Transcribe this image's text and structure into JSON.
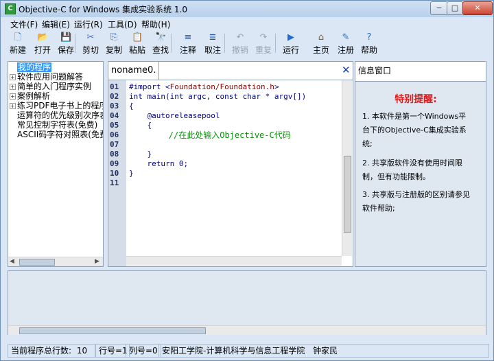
{
  "window": {
    "title": "Objective-C for Windows 集成实验系统 1.0",
    "app_icon_glyph": "C",
    "min_glyph": "−",
    "max_glyph": "□",
    "close_glyph": "✕"
  },
  "menu": [
    {
      "label": "文件(F)"
    },
    {
      "label": "编辑(E)"
    },
    {
      "label": "运行(R)"
    },
    {
      "label": "工具(D)"
    },
    {
      "label": "帮助(H)"
    }
  ],
  "toolbar": [
    {
      "label": "新建",
      "icon": "new-file-icon",
      "glyph": "🗋",
      "color": "#3a6fb0",
      "disabled": false
    },
    {
      "label": "打开",
      "icon": "open-folder-icon",
      "glyph": "📂",
      "color": "#d9a52b",
      "disabled": false
    },
    {
      "label": "保存",
      "icon": "save-icon",
      "glyph": "💾",
      "color": "#2e5aa8",
      "disabled": false
    },
    {
      "label": "剪切",
      "icon": "cut-icon",
      "glyph": "✂",
      "color": "#4a6fb0",
      "disabled": false
    },
    {
      "label": "复制",
      "icon": "copy-icon",
      "glyph": "⎘",
      "color": "#4a6fb0",
      "disabled": false
    },
    {
      "label": "粘贴",
      "icon": "paste-icon",
      "glyph": "📋",
      "color": "#b57c2e",
      "disabled": false
    },
    {
      "label": "查找",
      "icon": "find-icon",
      "glyph": "🔭",
      "color": "#333333",
      "disabled": false
    },
    {
      "label": "注释",
      "icon": "comment-icon",
      "glyph": "≡",
      "color": "#2e5aa8",
      "disabled": false
    },
    {
      "label": "取注",
      "icon": "uncomment-icon",
      "glyph": "≣",
      "color": "#2e5aa8",
      "disabled": false
    },
    {
      "label": "撤销",
      "icon": "undo-icon",
      "glyph": "↶",
      "color": "#9aa5b1",
      "disabled": true
    },
    {
      "label": "重复",
      "icon": "redo-icon",
      "glyph": "↷",
      "color": "#9aa5b1",
      "disabled": true
    },
    {
      "label": "运行",
      "icon": "run-icon",
      "glyph": "▶",
      "color": "#1f6fd0",
      "disabled": false
    },
    {
      "label": "主页",
      "icon": "home-icon",
      "glyph": "⌂",
      "color": "#8a5a2b",
      "disabled": false
    },
    {
      "label": "注册",
      "icon": "register-pen-icon",
      "glyph": "✎",
      "color": "#3a6fb0",
      "disabled": false
    },
    {
      "label": "帮助",
      "icon": "help-icon",
      "glyph": "?",
      "color": "#1f6fd0",
      "disabled": false
    }
  ],
  "tree": {
    "items": [
      {
        "label": "我的程序",
        "expander": "",
        "selected": true
      },
      {
        "label": "软件应用问题解答",
        "expander": "+",
        "selected": false
      },
      {
        "label": "简单的入门程序实例",
        "expander": "+",
        "selected": false
      },
      {
        "label": "案例解析",
        "expander": "+",
        "selected": false
      },
      {
        "label": "练习PDF电子书上的程序",
        "expander": "+",
        "selected": false
      },
      {
        "label": "运算符的优先级别次序表",
        "expander": "",
        "selected": false
      },
      {
        "label": "常见控制字符表(免费)",
        "expander": "",
        "selected": false
      },
      {
        "label": "ASCII码字符对照表(免费)",
        "expander": "",
        "selected": false
      }
    ]
  },
  "editor": {
    "tab_label": "noname0.",
    "close_glyph": "✕",
    "line_numbers": [
      "01",
      "02",
      "03",
      "04",
      "05",
      "06",
      "07",
      "08",
      "09",
      "10",
      "11"
    ],
    "code": [
      {
        "pre": "#import <",
        "mid": "Foundation/Foundation.h",
        "post": ">"
      },
      {
        "pre": "int main(int argc, const char * argv[])",
        "mid": "",
        "post": ""
      },
      {
        "pre": "{",
        "mid": "",
        "post": ""
      },
      {
        "pre": "    @autoreleasepool",
        "mid": "",
        "post": ""
      },
      {
        "pre": "    {",
        "mid": "",
        "post": ""
      },
      {
        "pre": "        //在此处输入Objective-C代码",
        "mid": "",
        "post": ""
      },
      {
        "pre": "",
        "mid": "",
        "post": ""
      },
      {
        "pre": "    }",
        "mid": "",
        "post": ""
      },
      {
        "pre": "    return 0;",
        "mid": "",
        "post": ""
      },
      {
        "pre": "}",
        "mid": "",
        "post": ""
      },
      {
        "pre": "",
        "mid": "",
        "post": ""
      }
    ]
  },
  "info": {
    "header": "信息窗口",
    "title": "特别提醒:",
    "paragraphs": [
      "1. 本软件是第一个Windows平台下的Objective-C集成实验系统;",
      "2. 共享版软件没有使用时间限制，但有功能限制。",
      "3. 共享版与注册版的区别请参见软件帮助;"
    ]
  },
  "status": {
    "total_label": "当前程序总行数:",
    "total_value": "10",
    "row": "行号=1",
    "col": "列号=0",
    "org": "安阳工学院-计算机科学与信息工程学院",
    "author": "钟家民"
  }
}
